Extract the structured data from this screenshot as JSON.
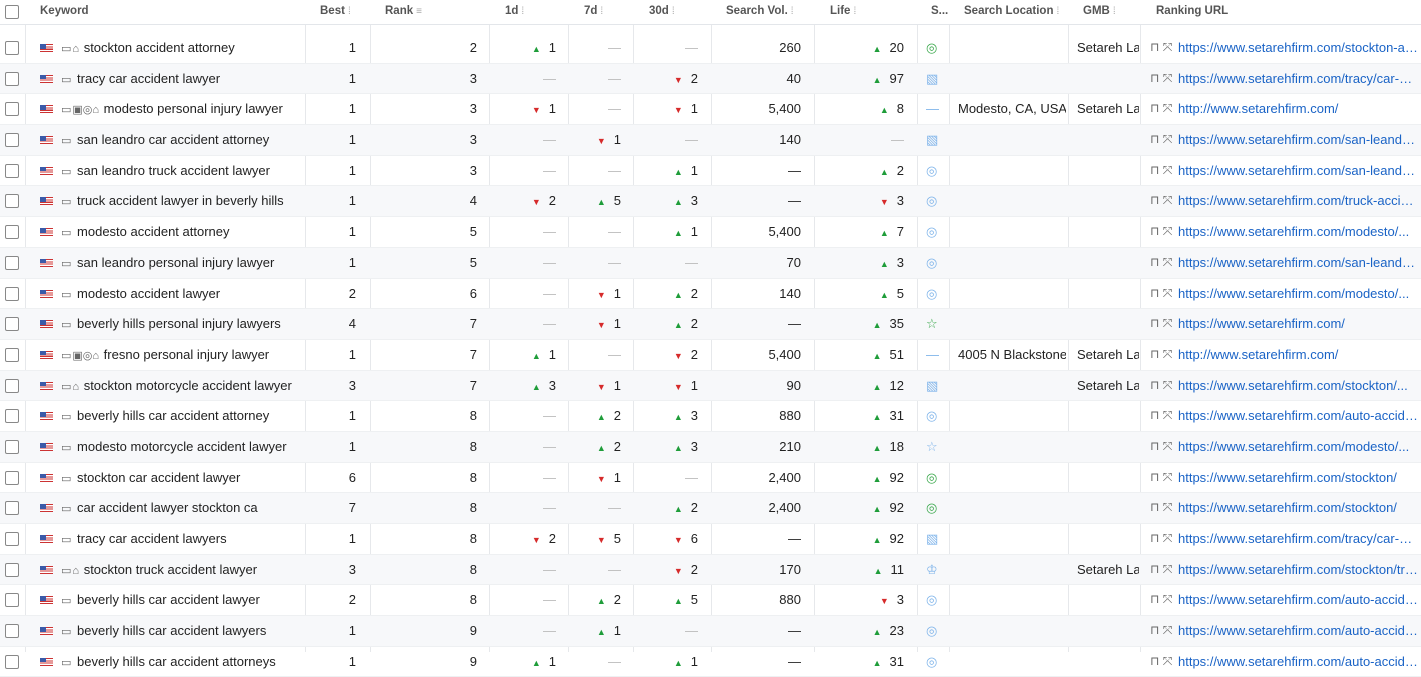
{
  "columns": {
    "keyword": "Keyword",
    "best": "Best",
    "rank": "Rank",
    "d1": "1d",
    "d7": "7d",
    "d30": "30d",
    "vol": "Search Vol.",
    "life": "Life",
    "serp": "S...",
    "loc": "Search Location",
    "gmb": "GMB",
    "url": "Ranking URL"
  },
  "rows": [
    {
      "kw": "stockton accident attorney",
      "icons": "⌂",
      "best": "1",
      "rank": "2",
      "d1": [
        "up",
        "1"
      ],
      "d7": [
        "-",
        ""
      ],
      "d30": [
        "-",
        ""
      ],
      "vol": "260",
      "life": [
        "up",
        "20"
      ],
      "serp": "pin-green",
      "loc": "",
      "gmb": "Setareh Lav",
      "url": "https://www.setarehfirm.com/stockton-accident..."
    },
    {
      "kw": "tracy car accident lawyer",
      "icons": "",
      "best": "1",
      "rank": "3",
      "d1": [
        "-",
        ""
      ],
      "d7": [
        "-",
        ""
      ],
      "d30": [
        "dn",
        "2"
      ],
      "vol": "40",
      "life": [
        "up",
        "97"
      ],
      "serp": "image",
      "loc": "",
      "gmb": "",
      "url": "https://www.setarehfirm.com/tracy/car-accident..."
    },
    {
      "kw": "modesto personal injury lawyer",
      "icons": "▣◎⌂",
      "best": "1",
      "rank": "3",
      "d1": [
        "dn",
        "1"
      ],
      "d7": [
        "-",
        ""
      ],
      "d30": [
        "dn",
        "1"
      ],
      "vol": "5,400",
      "life": [
        "up",
        "8"
      ],
      "serp": "dash",
      "loc": "Modesto, CA, USA",
      "gmb": "Setareh Lav",
      "url": "http://www.setarehfirm.com/"
    },
    {
      "kw": "san leandro car accident attorney",
      "icons": "",
      "best": "1",
      "rank": "3",
      "d1": [
        "-",
        ""
      ],
      "d7": [
        "dn",
        "1"
      ],
      "d30": [
        "-",
        ""
      ],
      "vol": "140",
      "life": [
        "-",
        ""
      ],
      "serp": "image",
      "loc": "",
      "gmb": "",
      "url": "https://www.setarehfirm.com/san-leandro/car..."
    },
    {
      "kw": "san leandro truck accident lawyer",
      "icons": "",
      "best": "1",
      "rank": "3",
      "d1": [
        "-",
        ""
      ],
      "d7": [
        "-",
        ""
      ],
      "d30": [
        "up",
        "1"
      ],
      "vol": "—",
      "life": [
        "up",
        "2"
      ],
      "serp": "pin",
      "loc": "",
      "gmb": "",
      "url": "https://www.setarehfirm.com/san-leandro/truck..."
    },
    {
      "kw": "truck accident lawyer in beverly hills",
      "icons": "",
      "best": "1",
      "rank": "4",
      "d1": [
        "dn",
        "2"
      ],
      "d7": [
        "up",
        "5"
      ],
      "d30": [
        "up",
        "3"
      ],
      "vol": "—",
      "life": [
        "dn",
        "3"
      ],
      "serp": "pin",
      "loc": "",
      "gmb": "",
      "url": "https://www.setarehfirm.com/truck-accident..."
    },
    {
      "kw": "modesto accident attorney",
      "icons": "",
      "best": "1",
      "rank": "5",
      "d1": [
        "-",
        ""
      ],
      "d7": [
        "-",
        ""
      ],
      "d30": [
        "up",
        "1"
      ],
      "vol": "5,400",
      "life": [
        "up",
        "7"
      ],
      "serp": "pin",
      "loc": "",
      "gmb": "",
      "url": "https://www.setarehfirm.com/modesto/..."
    },
    {
      "kw": "san leandro personal injury lawyer",
      "icons": "",
      "best": "1",
      "rank": "5",
      "d1": [
        "-",
        ""
      ],
      "d7": [
        "-",
        ""
      ],
      "d30": [
        "-",
        ""
      ],
      "vol": "70",
      "life": [
        "up",
        "3"
      ],
      "serp": "pin",
      "loc": "",
      "gmb": "",
      "url": "https://www.setarehfirm.com/san-leandro/..."
    },
    {
      "kw": "modesto accident lawyer",
      "icons": "",
      "best": "2",
      "rank": "6",
      "d1": [
        "-",
        ""
      ],
      "d7": [
        "dn",
        "1"
      ],
      "d30": [
        "up",
        "2"
      ],
      "vol": "140",
      "life": [
        "up",
        "5"
      ],
      "serp": "pin",
      "loc": "",
      "gmb": "",
      "url": "https://www.setarehfirm.com/modesto/..."
    },
    {
      "kw": "beverly hills personal injury lawyers",
      "icons": "",
      "best": "4",
      "rank": "7",
      "d1": [
        "-",
        ""
      ],
      "d7": [
        "dn",
        "1"
      ],
      "d30": [
        "up",
        "2"
      ],
      "vol": "—",
      "life": [
        "up",
        "35"
      ],
      "serp": "star-green",
      "loc": "",
      "gmb": "",
      "url": "https://www.setarehfirm.com/"
    },
    {
      "kw": "fresno personal injury lawyer",
      "icons": "▣◎⌂",
      "best": "1",
      "rank": "7",
      "d1": [
        "up",
        "1"
      ],
      "d7": [
        "-",
        ""
      ],
      "d30": [
        "dn",
        "2"
      ],
      "vol": "5,400",
      "life": [
        "up",
        "51"
      ],
      "serp": "dash",
      "loc": "4005 N Blackstone",
      "gmb": "Setareh Lav",
      "url": "http://www.setarehfirm.com/"
    },
    {
      "kw": "stockton motorcycle accident lawyer",
      "icons": "⌂",
      "best": "3",
      "rank": "7",
      "d1": [
        "up",
        "3"
      ],
      "d7": [
        "dn",
        "1"
      ],
      "d30": [
        "dn",
        "1"
      ],
      "vol": "90",
      "life": [
        "up",
        "12"
      ],
      "serp": "image",
      "loc": "",
      "gmb": "Setareh Lav",
      "url": "https://www.setarehfirm.com/stockton/..."
    },
    {
      "kw": "beverly hills car accident attorney",
      "icons": "",
      "best": "1",
      "rank": "8",
      "d1": [
        "-",
        ""
      ],
      "d7": [
        "up",
        "2"
      ],
      "d30": [
        "up",
        "3"
      ],
      "vol": "880",
      "life": [
        "up",
        "31"
      ],
      "serp": "pin",
      "loc": "",
      "gmb": "",
      "url": "https://www.setarehfirm.com/auto-accident..."
    },
    {
      "kw": "modesto motorcycle accident lawyer",
      "icons": "",
      "best": "1",
      "rank": "8",
      "d1": [
        "-",
        ""
      ],
      "d7": [
        "up",
        "2"
      ],
      "d30": [
        "up",
        "3"
      ],
      "vol": "210",
      "life": [
        "up",
        "18"
      ],
      "serp": "star",
      "loc": "",
      "gmb": "",
      "url": "https://www.setarehfirm.com/modesto/..."
    },
    {
      "kw": "stockton car accident lawyer",
      "icons": "",
      "best": "6",
      "rank": "8",
      "d1": [
        "-",
        ""
      ],
      "d7": [
        "dn",
        "1"
      ],
      "d30": [
        "-",
        ""
      ],
      "vol": "2,400",
      "life": [
        "up",
        "92"
      ],
      "serp": "pin-green",
      "loc": "",
      "gmb": "",
      "url": "https://www.setarehfirm.com/stockton/"
    },
    {
      "kw": "car accident lawyer stockton ca",
      "icons": "",
      "best": "7",
      "rank": "8",
      "d1": [
        "-",
        ""
      ],
      "d7": [
        "-",
        ""
      ],
      "d30": [
        "up",
        "2"
      ],
      "vol": "2,400",
      "life": [
        "up",
        "92"
      ],
      "serp": "pin-green",
      "loc": "",
      "gmb": "",
      "url": "https://www.setarehfirm.com/stockton/"
    },
    {
      "kw": "tracy car accident lawyers",
      "icons": "",
      "best": "1",
      "rank": "8",
      "d1": [
        "dn",
        "2"
      ],
      "d7": [
        "dn",
        "5"
      ],
      "d30": [
        "dn",
        "6"
      ],
      "vol": "—",
      "life": [
        "up",
        "92"
      ],
      "serp": "image",
      "loc": "",
      "gmb": "",
      "url": "https://www.setarehfirm.com/tracy/car-accident..."
    },
    {
      "kw": "stockton truck accident lawyer",
      "icons": "⌂",
      "best": "3",
      "rank": "8",
      "d1": [
        "-",
        ""
      ],
      "d7": [
        "-",
        ""
      ],
      "d30": [
        "dn",
        "2"
      ],
      "vol": "170",
      "life": [
        "up",
        "11"
      ],
      "serp": "crown",
      "loc": "",
      "gmb": "Setareh Lav",
      "url": "https://www.setarehfirm.com/stockton/truck..."
    },
    {
      "kw": "beverly hills car accident lawyer",
      "icons": "",
      "best": "2",
      "rank": "8",
      "d1": [
        "-",
        ""
      ],
      "d7": [
        "up",
        "2"
      ],
      "d30": [
        "up",
        "5"
      ],
      "vol": "880",
      "life": [
        "dn",
        "3"
      ],
      "serp": "pin",
      "loc": "",
      "gmb": "",
      "url": "https://www.setarehfirm.com/auto-accident..."
    },
    {
      "kw": "beverly hills car accident lawyers",
      "icons": "",
      "best": "1",
      "rank": "9",
      "d1": [
        "-",
        ""
      ],
      "d7": [
        "up",
        "1"
      ],
      "d30": [
        "-",
        ""
      ],
      "vol": "—",
      "life": [
        "up",
        "23"
      ],
      "serp": "pin",
      "loc": "",
      "gmb": "",
      "url": "https://www.setarehfirm.com/auto-accident..."
    },
    {
      "kw": "beverly hills car accident attorneys",
      "icons": "",
      "best": "1",
      "rank": "9",
      "d1": [
        "up",
        "1"
      ],
      "d7": [
        "-",
        ""
      ],
      "d30": [
        "up",
        "1"
      ],
      "vol": "—",
      "life": [
        "up",
        "31"
      ],
      "serp": "pin",
      "loc": "",
      "gmb": "",
      "url": "https://www.setarehfirm.com/auto-accident..."
    }
  ]
}
